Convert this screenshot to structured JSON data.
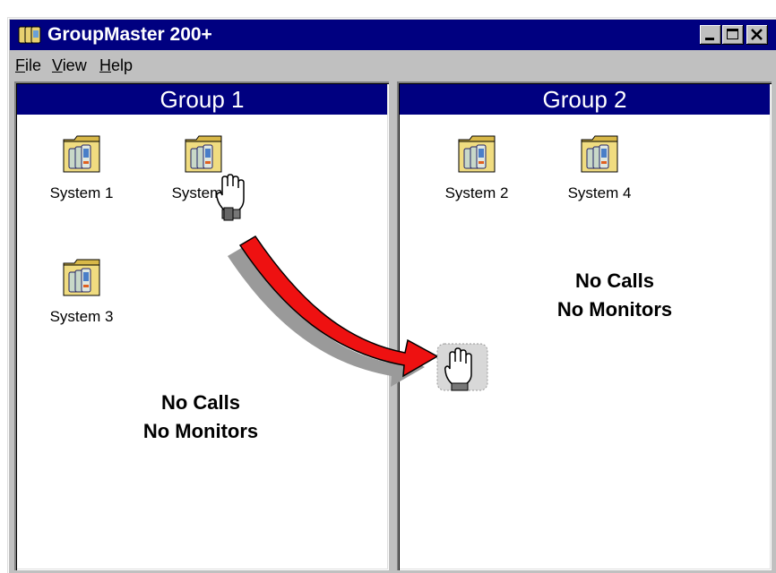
{
  "window": {
    "title": "GroupMaster 200+",
    "controls": [
      "minimize",
      "maximize",
      "close"
    ]
  },
  "menu": [
    {
      "label": "File"
    },
    {
      "label": "View"
    },
    {
      "label": "Help"
    }
  ],
  "groups": [
    {
      "header": "Group 1",
      "systems": [
        {
          "label": "System 1",
          "icon": "system-folder-icon"
        },
        {
          "label": "System 5",
          "icon": "system-folder-icon",
          "state": "being dragged"
        },
        {
          "label": "System 3",
          "icon": "system-folder-icon"
        }
      ],
      "status_line1": "No Calls",
      "status_line2": "No Monitors"
    },
    {
      "header": "Group 2",
      "systems": [
        {
          "label": "System 2",
          "icon": "system-folder-icon"
        },
        {
          "label": "System 4",
          "icon": "system-folder-icon"
        }
      ],
      "status_line1": "No Calls",
      "status_line2": "No Monitors"
    }
  ],
  "drag": {
    "icon": "grab-hand-cursor-icon",
    "arrow": "red-curved-arrow-icon"
  },
  "colors": {
    "title_bar": "#000080",
    "face": "#c0c0c0",
    "folder": "#e8d070",
    "arrow": "#ee1111"
  }
}
